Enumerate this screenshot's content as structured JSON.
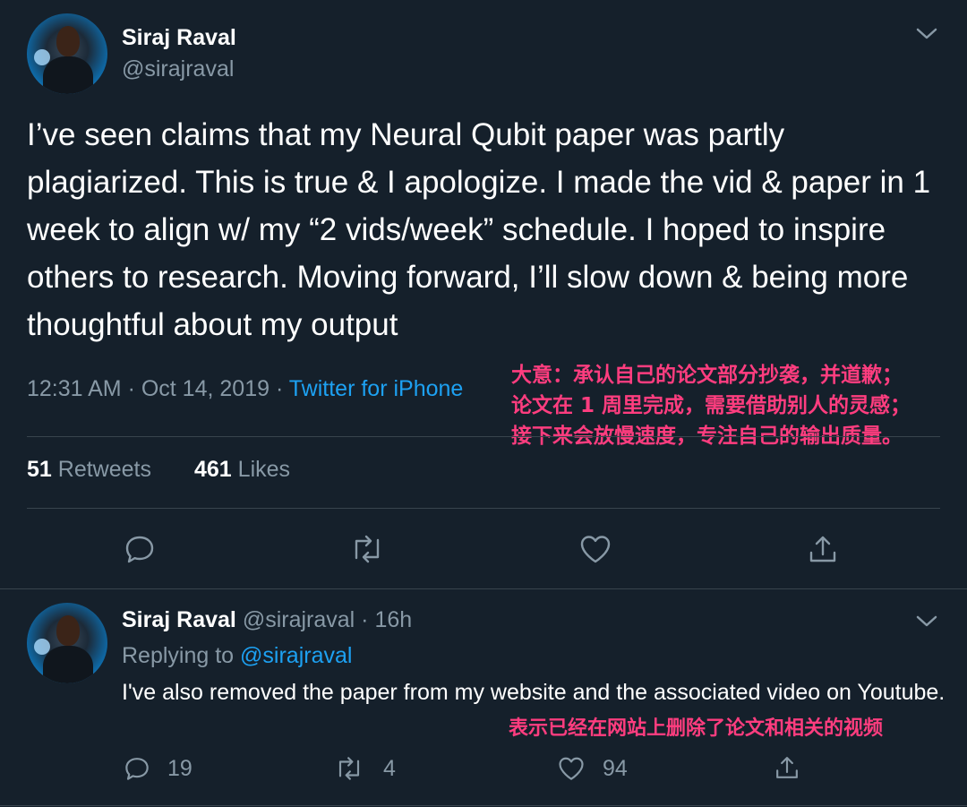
{
  "main_tweet": {
    "author_name": "Siraj Raval",
    "author_handle": "@sirajraval",
    "text": "I’ve seen claims that my Neural Qubit paper was partly plagiarized. This is true & I apologize. I made the vid & paper in 1 week to align w/ my “2 vids/week” schedule. I hoped to inspire others to research. Moving forward, I’ll slow down & being more thoughtful about my output",
    "time": "12:31 AM · Oct 14, 2019 ·",
    "source": "Twitter for iPhone",
    "retweets_count": "51",
    "retweets_label": "Retweets",
    "likes_count": "461",
    "likes_label": "Likes"
  },
  "annotation_1": {
    "line1": "大意：承认自己的论文部分抄袭，并道歉；",
    "line2": "论文在 1 周里完成，需要借助别人的灵感；",
    "line3": "接下来会放慢速度，专注自己的输出质量。"
  },
  "reply_tweet": {
    "author_name": "Siraj Raval",
    "author_handle": "@sirajraval",
    "age": "· 16h",
    "replying_prefix": "Replying to",
    "replying_to": "@sirajraval",
    "text": "I've also removed the paper from my website and the associated video on Youtube.",
    "reply_count": "19",
    "retweet_count": "4",
    "like_count": "94"
  },
  "annotation_2": "表示已经在网站上删除了论文和相关的视频",
  "colors": {
    "background": "#15202b",
    "secondary_text": "#8899a6",
    "link": "#1da1f2",
    "annotation": "#ff3d7f",
    "divider": "#38444d"
  },
  "icons": [
    "chevron-down-icon",
    "reply-icon",
    "retweet-icon",
    "like-icon",
    "share-icon"
  ]
}
